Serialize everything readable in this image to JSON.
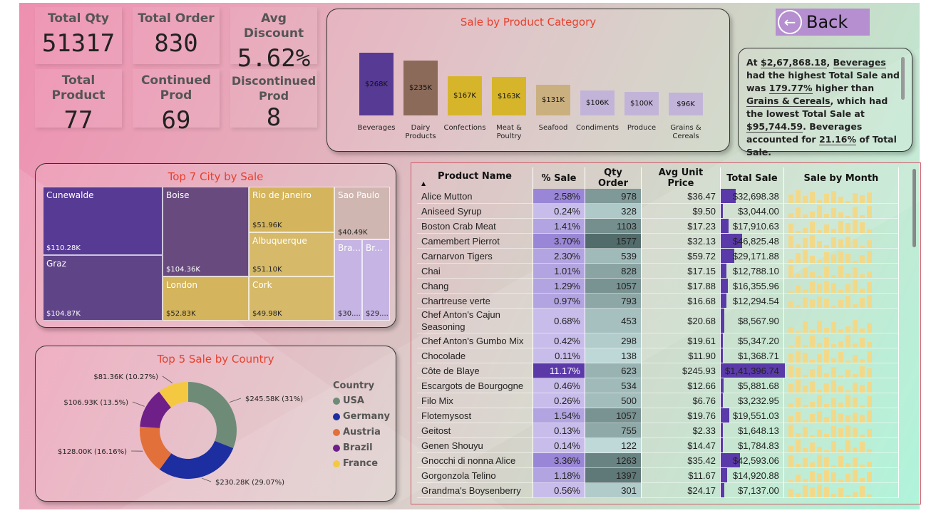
{
  "kpis": [
    {
      "label": "Total Qty",
      "value": "51317"
    },
    {
      "label": "Total Order",
      "value": "830"
    },
    {
      "label": "Avg Discount",
      "value": "5.62%"
    },
    {
      "label": "Total Product",
      "value": "77"
    },
    {
      "label": "Continued Prod",
      "value": "69"
    },
    {
      "label": "Discontinued Prod",
      "value": "8"
    }
  ],
  "back": {
    "label": "Back"
  },
  "narrative": {
    "p1": "At ",
    "amount": "$2,67,868.18",
    "p2": ", ",
    "cat1": "Beverages",
    "p3": " had the highest Total Sale and was ",
    "pct": "179.77%",
    "p4": " higher than ",
    "cat2": "Grains & Cereals",
    "p5": ", which had the lowest Total Sale at ",
    "low": "$95,744.59",
    "p6": ". ",
    "cat3": "Beverages",
    "p7": " accounted for ",
    "share": "21.16%",
    "p8": " of Total Sale."
  },
  "category_chart": {
    "title": "Sale by Product Category",
    "chart_data": {
      "type": "bar",
      "categories": [
        "Beverages",
        "Dairy Products",
        "Confections",
        "Meat & Poultry",
        "Seafood",
        "Condiments",
        "Produce",
        "Grains & Cereals"
      ],
      "values": [
        268,
        235,
        167,
        163,
        131,
        106,
        100,
        96
      ],
      "labels": [
        "$268K",
        "$235K",
        "$167K",
        "$163K",
        "$131K",
        "$106K",
        "$100K",
        "$96K"
      ],
      "colors": [
        "#563a94",
        "#8b6a5a",
        "#d6b52b",
        "#d6b52b",
        "#cbb07f",
        "#c2b4d8",
        "#c2b4d8",
        "#c2b4d8"
      ]
    }
  },
  "city_chart": {
    "title": "Top 7 City by Sale",
    "cells": [
      {
        "name": "Cunewalde",
        "value": "$110.28K",
        "color": "#563a94"
      },
      {
        "name": "Graz",
        "value": "$104.87K",
        "color": "#5f4488"
      },
      {
        "name": "Boise",
        "value": "$104.36K",
        "color": "#684a7e"
      },
      {
        "name": "London",
        "value": "$52.83K",
        "color": "#d4b45c"
      },
      {
        "name": "Rio de Janeiro",
        "value": "$51.96K",
        "color": "#d4b45c"
      },
      {
        "name": "Albuquerque",
        "value": "$51.10K",
        "color": "#d6ba6a"
      },
      {
        "name": "Cork",
        "value": "$49.98K",
        "color": "#d6ba6a"
      },
      {
        "name": "Sao Paulo",
        "value": "$40.49K",
        "color": "#cfb6b0"
      },
      {
        "name": "Bra...",
        "value": "$30....",
        "color": "#c6b4e4"
      },
      {
        "name": "Br...",
        "value": "$29....",
        "color": "#c6b4e4"
      }
    ]
  },
  "country_chart": {
    "title": "Top 5 Sale by Country",
    "legend_title": "Country",
    "chart_data": {
      "type": "pie",
      "series": [
        {
          "name": "USA",
          "value": 245.58,
          "label": "$245.58K (31%)",
          "color": "#6e8b78"
        },
        {
          "name": "Germany",
          "value": 230.28,
          "label": "$230.28K (29.07%)",
          "color": "#1c2ea0"
        },
        {
          "name": "Austria",
          "value": 128.0,
          "label": "$128.00K (16.16%)",
          "color": "#e2703a"
        },
        {
          "name": "Brazil",
          "value": 106.93,
          "label": "$106.93K (13.5%)",
          "color": "#6f1f88"
        },
        {
          "name": "France",
          "value": 81.36,
          "label": "$81.36K (10.27%)",
          "color": "#f5c842"
        }
      ]
    }
  },
  "table": {
    "headers": [
      "Product Name",
      "% Sale",
      "Qty Order",
      "Avg Unit Price",
      "Total Sale",
      "Sale by Month"
    ],
    "rows": [
      {
        "name": "Alice Mutton",
        "pct": "2.58%",
        "qty": "978",
        "price": "$36.47",
        "total": "$32,698.38",
        "t": 32698
      },
      {
        "name": "Aniseed Syrup",
        "pct": "0.24%",
        "qty": "328",
        "price": "$9.50",
        "total": "$3,044.00",
        "t": 3044
      },
      {
        "name": "Boston Crab Meat",
        "pct": "1.41%",
        "qty": "1103",
        "price": "$17.23",
        "total": "$17,910.63",
        "t": 17910
      },
      {
        "name": "Camembert Pierrot",
        "pct": "3.70%",
        "qty": "1577",
        "price": "$32.13",
        "total": "$46,825.48",
        "t": 46825
      },
      {
        "name": "Carnarvon Tigers",
        "pct": "2.30%",
        "qty": "539",
        "price": "$59.72",
        "total": "$29,171.88",
        "t": 29171
      },
      {
        "name": "Chai",
        "pct": "1.01%",
        "qty": "828",
        "price": "$17.15",
        "total": "$12,788.10",
        "t": 12788
      },
      {
        "name": "Chang",
        "pct": "1.29%",
        "qty": "1057",
        "price": "$17.88",
        "total": "$16,355.96",
        "t": 16355
      },
      {
        "name": "Chartreuse verte",
        "pct": "0.97%",
        "qty": "793",
        "price": "$16.68",
        "total": "$12,294.54",
        "t": 12294
      },
      {
        "name": "Chef Anton's Cajun Seasoning",
        "pct": "0.68%",
        "qty": "453",
        "price": "$20.68",
        "total": "$8,567.90",
        "t": 8567
      },
      {
        "name": "Chef Anton's Gumbo Mix",
        "pct": "0.42%",
        "qty": "298",
        "price": "$19.61",
        "total": "$5,347.20",
        "t": 5347
      },
      {
        "name": "Chocolade",
        "pct": "0.11%",
        "qty": "138",
        "price": "$11.90",
        "total": "$1,368.71",
        "t": 1368
      },
      {
        "name": "Côte de Blaye",
        "pct": "11.17%",
        "qty": "623",
        "price": "$245.93",
        "total": "$1,41,396.74",
        "t": 141396
      },
      {
        "name": "Escargots de Bourgogne",
        "pct": "0.46%",
        "qty": "534",
        "price": "$12.66",
        "total": "$5,881.68",
        "t": 5881
      },
      {
        "name": "Filo Mix",
        "pct": "0.26%",
        "qty": "500",
        "price": "$6.76",
        "total": "$3,232.95",
        "t": 3232
      },
      {
        "name": "Flotemysost",
        "pct": "1.54%",
        "qty": "1057",
        "price": "$19.76",
        "total": "$19,551.03",
        "t": 19551
      },
      {
        "name": "Geitost",
        "pct": "0.13%",
        "qty": "755",
        "price": "$2.33",
        "total": "$1,648.13",
        "t": 1648
      },
      {
        "name": "Genen Shouyu",
        "pct": "0.14%",
        "qty": "122",
        "price": "$14.47",
        "total": "$1,784.83",
        "t": 1784
      },
      {
        "name": "Gnocchi di nonna Alice",
        "pct": "3.36%",
        "qty": "1263",
        "price": "$35.42",
        "total": "$42,593.06",
        "t": 42593
      },
      {
        "name": "Gorgonzola Telino",
        "pct": "1.18%",
        "qty": "1397",
        "price": "$11.67",
        "total": "$14,920.88",
        "t": 14920
      },
      {
        "name": "Grandma's Boysenberry",
        "pct": "0.56%",
        "qty": "301",
        "price": "$24.17",
        "total": "$7,137.00",
        "t": 7137
      }
    ]
  }
}
